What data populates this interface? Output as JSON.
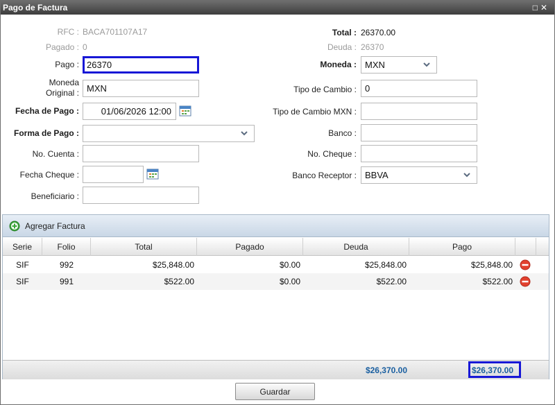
{
  "window": {
    "title": "Pago de Factura",
    "min_glyph": "□",
    "close_glyph": "✕"
  },
  "form": {
    "rfc_label": "RFC :",
    "rfc_value": "BACA701107A17",
    "pagado_label": "Pagado :",
    "pagado_value": "0",
    "pago_label": "Pago :",
    "pago_value": "26370",
    "moneda_orig_label_1": "Moneda",
    "moneda_orig_label_2": "Original :",
    "moneda_orig_value": "MXN",
    "fecha_pago_label": "Fecha de Pago :",
    "fecha_pago_value": "01/06/2026 12:00",
    "forma_pago_label": "Forma de Pago :",
    "forma_pago_value": "",
    "no_cuenta_label": "No. Cuenta :",
    "no_cuenta_value": "",
    "fecha_cheque_label": "Fecha Cheque :",
    "fecha_cheque_value": "",
    "beneficiario_label": "Beneficiario :",
    "beneficiario_value": "",
    "total_label": "Total :",
    "total_value": "26370.00",
    "deuda_label": "Deuda :",
    "deuda_value": "26370",
    "moneda_label": "Moneda :",
    "moneda_value": "MXN",
    "tipo_cambio_label": "Tipo de Cambio :",
    "tipo_cambio_value": "0",
    "tipo_cambio_mxn_label": "Tipo de Cambio MXN :",
    "tipo_cambio_mxn_value": "",
    "banco_label": "Banco :",
    "banco_value": "",
    "no_cheque_label": "No. Cheque :",
    "no_cheque_value": "",
    "banco_receptor_label": "Banco Receptor :",
    "banco_receptor_value": "BBVA"
  },
  "grid": {
    "add_label": "Agregar Factura",
    "headers": {
      "serie": "Serie",
      "folio": "Folio",
      "total": "Total",
      "pagado": "Pagado",
      "deuda": "Deuda",
      "pago": "Pago"
    },
    "rows": [
      {
        "serie": "SIF",
        "folio": "992",
        "total": "$25,848.00",
        "pagado": "$0.00",
        "deuda": "$25,848.00",
        "pago": "$25,848.00"
      },
      {
        "serie": "SIF",
        "folio": "991",
        "total": "$522.00",
        "pagado": "$0.00",
        "deuda": "$522.00",
        "pago": "$522.00"
      }
    ],
    "footer_deuda": "$26,370.00",
    "footer_pago": "$26,370.00"
  },
  "actions": {
    "guardar": "Guardar"
  },
  "colors": {
    "focus_border": "#1717d6",
    "footer_text": "#1a5fa0",
    "delete_red": "#e2412f",
    "add_green": "#3aa63a"
  }
}
